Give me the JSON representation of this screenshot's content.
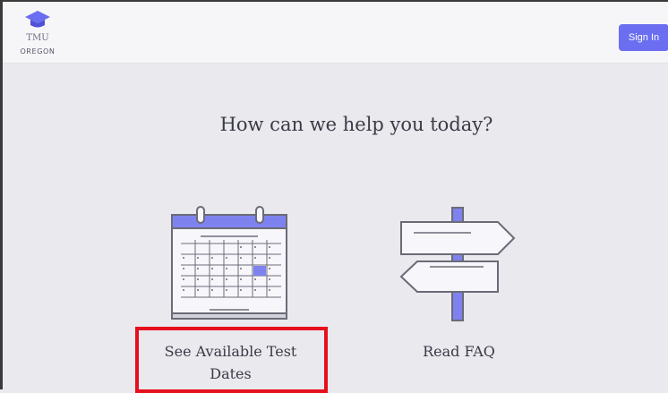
{
  "header": {
    "logo_name": "TMU",
    "logo_subtitle": "OREGON",
    "signin_label": "Sign In"
  },
  "main": {
    "headline": "How can we help you today?",
    "options": [
      {
        "label": "See Available Test Dates",
        "icon": "calendar-icon"
      },
      {
        "label": "Read FAQ",
        "icon": "signpost-icon"
      }
    ]
  },
  "colors": {
    "accent": "#6b6ef0",
    "highlight": "#e5101c",
    "background": "#e9e9ee"
  }
}
